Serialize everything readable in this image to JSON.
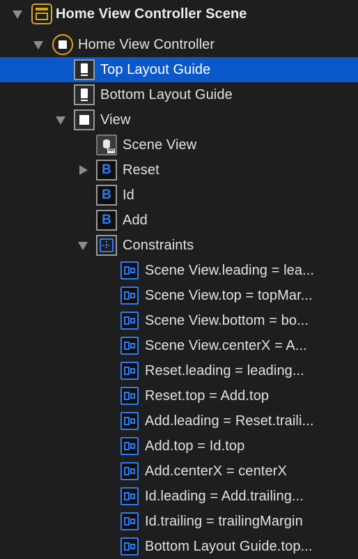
{
  "outline": {
    "items": [
      {
        "label": "Home View Controller Scene",
        "icon": "scene-icon",
        "disclosure": "open",
        "selected": false
      },
      {
        "label": "Home View Controller",
        "icon": "view-controller-icon",
        "disclosure": "open",
        "selected": false
      },
      {
        "label": "Top Layout Guide",
        "icon": "layout-guide-icon",
        "disclosure": "none",
        "selected": true
      },
      {
        "label": "Bottom Layout Guide",
        "icon": "layout-guide-icon",
        "disclosure": "none",
        "selected": false
      },
      {
        "label": "View",
        "icon": "view-icon",
        "disclosure": "open",
        "selected": false
      },
      {
        "label": "Scene View",
        "icon": "ar-scene-view-icon",
        "disclosure": "none",
        "selected": false
      },
      {
        "label": "Reset",
        "icon": "button-icon",
        "disclosure": "closed",
        "selected": false
      },
      {
        "label": "Id",
        "icon": "button-icon",
        "disclosure": "none",
        "selected": false
      },
      {
        "label": "Add",
        "icon": "button-icon",
        "disclosure": "none",
        "selected": false
      },
      {
        "label": "Constraints",
        "icon": "constraints-icon",
        "disclosure": "open",
        "selected": false
      },
      {
        "label": "Scene View.leading = lea...",
        "icon": "constraint-icon",
        "disclosure": "none",
        "selected": false
      },
      {
        "label": "Scene View.top = topMar...",
        "icon": "constraint-icon",
        "disclosure": "none",
        "selected": false
      },
      {
        "label": "Scene View.bottom = bo...",
        "icon": "constraint-icon",
        "disclosure": "none",
        "selected": false
      },
      {
        "label": "Scene View.centerX = A...",
        "icon": "constraint-icon",
        "disclosure": "none",
        "selected": false
      },
      {
        "label": "Reset.leading = leading...",
        "icon": "constraint-icon",
        "disclosure": "none",
        "selected": false
      },
      {
        "label": "Reset.top = Add.top",
        "icon": "constraint-icon",
        "disclosure": "none",
        "selected": false
      },
      {
        "label": "Add.leading = Reset.traili...",
        "icon": "constraint-icon",
        "disclosure": "none",
        "selected": false
      },
      {
        "label": "Add.top = Id.top",
        "icon": "constraint-icon",
        "disclosure": "none",
        "selected": false
      },
      {
        "label": "Add.centerX = centerX",
        "icon": "constraint-icon",
        "disclosure": "none",
        "selected": false
      },
      {
        "label": "Id.leading = Add.trailing...",
        "icon": "constraint-icon",
        "disclosure": "none",
        "selected": false
      },
      {
        "label": "Id.trailing = trailingMargin",
        "icon": "constraint-icon",
        "disclosure": "none",
        "selected": false
      },
      {
        "label": "Bottom Layout Guide.top...",
        "icon": "constraint-icon",
        "disclosure": "none",
        "selected": false
      }
    ]
  },
  "button_icon_glyph": "B",
  "ar_badge_text": "AR",
  "colors": {
    "background": "#1e1e1e",
    "selection": "#0a58ca",
    "accent_blue": "#2f7cf6",
    "scene_yellow": "#e3a21a"
  }
}
